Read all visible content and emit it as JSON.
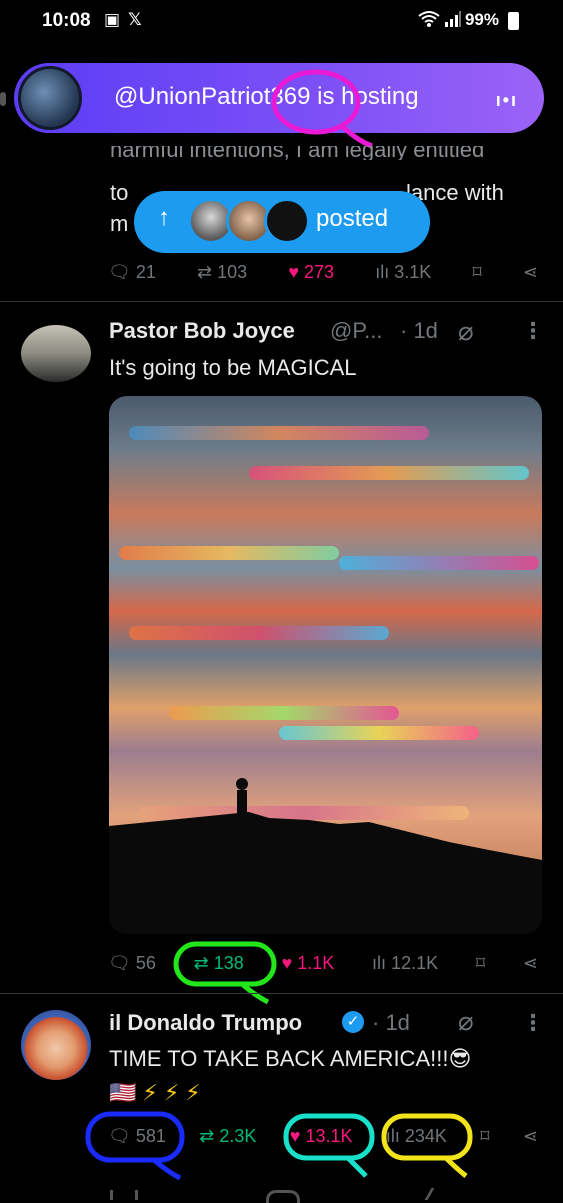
{
  "status_bar": {
    "time": "10:08",
    "battery": "99%",
    "icons_left": [
      "image-icon",
      "x-logo-icon"
    ],
    "icons_right": [
      "wifi-icon",
      "signal-icon",
      "battery-icon"
    ]
  },
  "space": {
    "title": "@UnionPatriot369 is hosting"
  },
  "partial_tweet": {
    "line1": "harmful intentions, I am legally entitled",
    "line2_start": "to",
    "line2_end": "lance with",
    "line3_start": "m",
    "posted_label": "posted",
    "replies": "21",
    "reposts": "103",
    "likes": "273",
    "views": "3.1K"
  },
  "tweet1": {
    "name": "Pastor Bob Joyce",
    "handle": "@P...",
    "time": "· 1d",
    "text": "It's going to be MAGICAL",
    "replies": "56",
    "reposts": "138",
    "likes": "1.1K",
    "views": "12.1K"
  },
  "tweet2": {
    "name": "il Donaldo Trumpo",
    "time": "· 1d",
    "text": "TIME TO TAKE BACK AMERICA!!!😎",
    "emoji_line": "🇺🇸⚡⚡⚡",
    "replies": "581",
    "reposts": "2.3K",
    "likes": "13.1K",
    "views": "234K"
  },
  "colors": {
    "accent": "#1d9bf0",
    "like": "#f91880",
    "repost": "#00ba7c",
    "muted": "#71767b",
    "space_gradient": "#7b4ff6"
  }
}
